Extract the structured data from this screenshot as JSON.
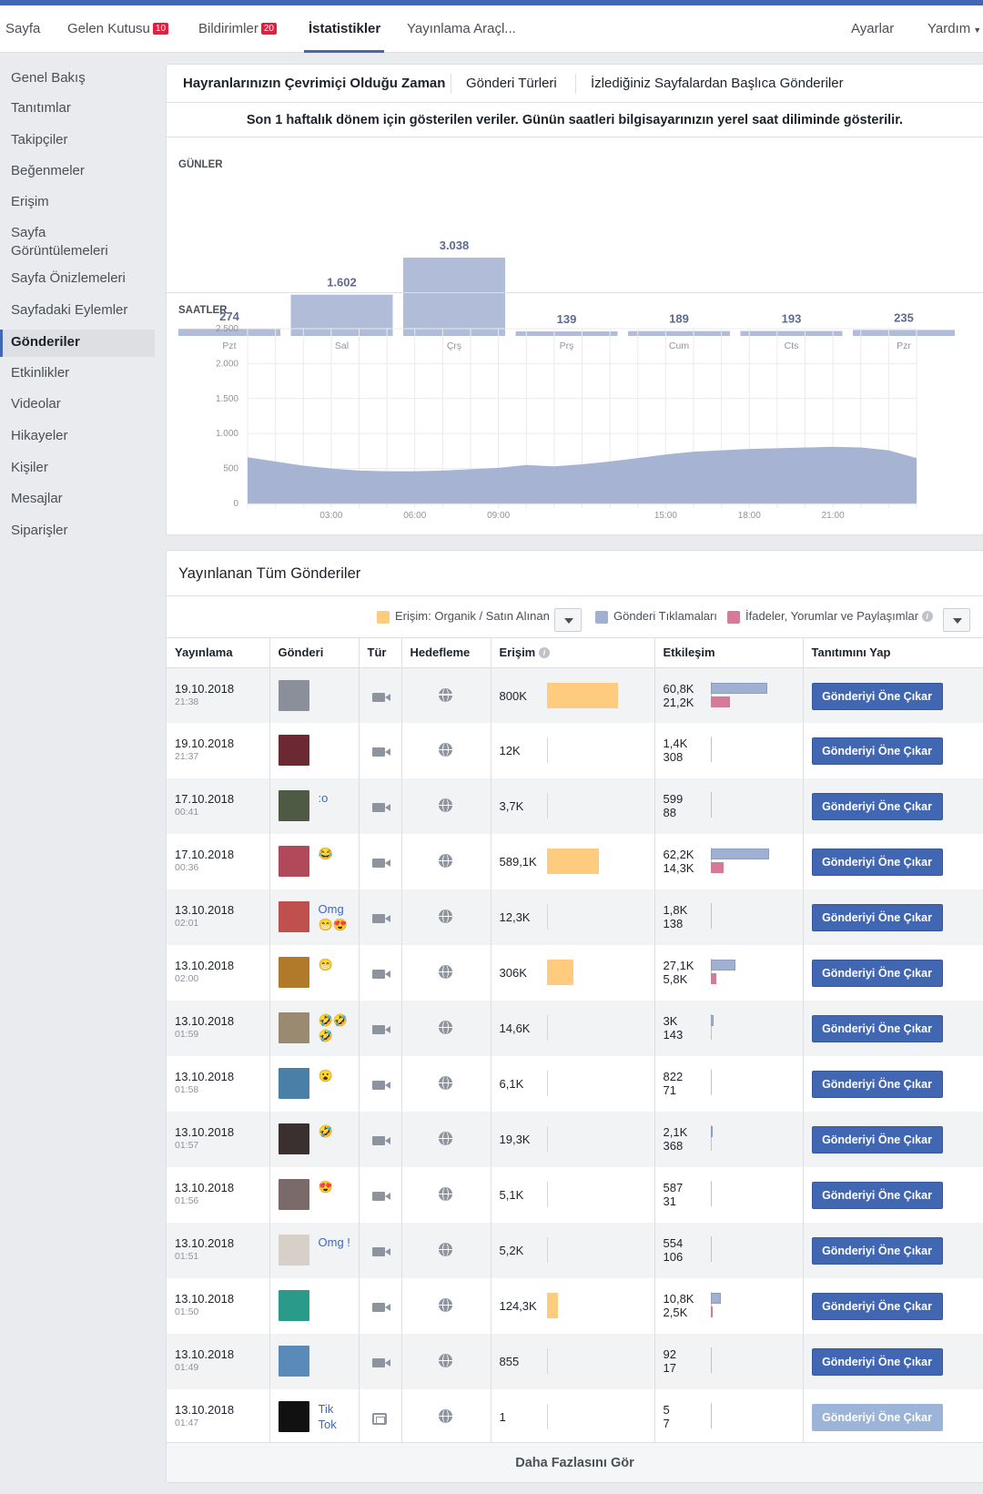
{
  "topnav": {
    "items": [
      {
        "label": "Sayfa"
      },
      {
        "label": "Gelen Kutusu",
        "badge": "10"
      },
      {
        "label": "Bildirimler",
        "badge": "20"
      },
      {
        "label": "İstatistikler"
      },
      {
        "label": "Yayınlama Araçl..."
      }
    ],
    "settings": "Ayarlar",
    "help": "Yardım"
  },
  "sidebar": {
    "items": [
      "Genel Bakış",
      "Tanıtımlar",
      "Takipçiler",
      "Beğenmeler",
      "Erişim",
      "Sayfa Görüntülemeleri",
      "Sayfa Önizlemeleri",
      "Sayfadaki Eylemler",
      "Gönderiler",
      "Etkinlikler",
      "Videolar",
      "Hikayeler",
      "Kişiler",
      "Mesajlar",
      "Siparişler"
    ],
    "active_index": 8
  },
  "insights": {
    "tabs": [
      "Hayranlarınızın Çevrimiçi Olduğu Zaman",
      "Gönderi Türleri",
      "İzlediğiniz Sayfalardan Başlıca Gönderiler"
    ],
    "notice": "Son 1 haftalık dönem için gösterilen veriler. Günün saatleri bilgisayarınızın yerel saat diliminde gösterilir.",
    "days_title": "GÜNLER",
    "hours_title": "SAATLER"
  },
  "chart_data": [
    {
      "type": "bar",
      "title": "GÜNLER",
      "categories": [
        "Pzt",
        "Sal",
        "Çrş",
        "Prş",
        "Cum",
        "Cts",
        "Pzr"
      ],
      "values": [
        274,
        1602,
        3038,
        139,
        189,
        193,
        235
      ],
      "value_labels": [
        "274",
        "1.602",
        "3.038",
        "139",
        "189",
        "193",
        "235"
      ],
      "color": "#b1bcd9"
    },
    {
      "type": "area",
      "title": "SAATLER",
      "x_ticks": [
        "03:00",
        "06:00",
        "09:00",
        "15:00",
        "18:00",
        "21:00"
      ],
      "y_ticks": [
        "0",
        "500",
        "1.000",
        "1.500",
        "2.000",
        "2.500"
      ],
      "ylim": [
        0,
        2500
      ],
      "x": [
        0,
        1,
        2,
        3,
        4,
        5,
        6,
        7,
        8,
        9,
        10,
        11,
        12,
        13,
        14,
        15,
        16,
        17,
        18,
        19,
        20,
        21,
        22,
        23,
        24
      ],
      "values": [
        660,
        600,
        540,
        500,
        470,
        460,
        460,
        470,
        490,
        510,
        550,
        530,
        560,
        600,
        650,
        700,
        740,
        760,
        780,
        790,
        800,
        810,
        800,
        760,
        650
      ],
      "color": "#a7b3d3",
      "grid": true
    }
  ],
  "posts": {
    "title": "Yayınlanan Tüm Gönderiler",
    "legend": {
      "reach": "Erişim: Organik / Satın Alınan",
      "clicks": "Gönderi Tıklamaları",
      "reactions": "İfadeler, Yorumlar ve Paylaşımlar",
      "reach_color": "#ffcc7f",
      "clicks_color": "#9fb0d3",
      "reactions_color": "#d77a98"
    },
    "columns": [
      "Yayınlama",
      "Gönderi",
      "Tür",
      "Hedefleme",
      "Erişim",
      "Etkileşim",
      "Tanıtımını Yap"
    ],
    "boost_label": "Gönderiyi Öne Çıkar",
    "more_label": "Daha Fazlasını Gör",
    "rows": [
      {
        "date": "19.10.2018",
        "time": "21:38",
        "text": "",
        "type": "video",
        "reach": "800K",
        "reach_value": 800000,
        "eng1": "60,8K",
        "eng1_value": 60800,
        "eng2": "21,2K",
        "eng2_value": 21200,
        "thumb_color": "#8a8f99",
        "boost_enabled": true
      },
      {
        "date": "19.10.2018",
        "time": "21:37",
        "text": "",
        "type": "video",
        "reach": "12K",
        "reach_value": 12000,
        "eng1": "1,4K",
        "eng1_value": 1400,
        "eng2": "308",
        "eng2_value": 308,
        "thumb_color": "#6b2a33",
        "boost_enabled": true
      },
      {
        "date": "17.10.2018",
        "time": "00:41",
        "text": ":o",
        "type": "video",
        "reach": "3,7K",
        "reach_value": 3700,
        "eng1": "599",
        "eng1_value": 599,
        "eng2": "88",
        "eng2_value": 88,
        "thumb_color": "#4f5a44",
        "boost_enabled": true
      },
      {
        "date": "17.10.2018",
        "time": "00:36",
        "text": "😂",
        "type": "video",
        "reach": "589,1K",
        "reach_value": 589100,
        "eng1": "62,2K",
        "eng1_value": 62200,
        "eng2": "14,3K",
        "eng2_value": 14300,
        "thumb_color": "#b04a5a",
        "boost_enabled": true
      },
      {
        "date": "13.10.2018",
        "time": "02:01",
        "text": "Omg 😁😍",
        "type": "video",
        "reach": "12,3K",
        "reach_value": 12300,
        "eng1": "1,8K",
        "eng1_value": 1800,
        "eng2": "138",
        "eng2_value": 138,
        "thumb_color": "#c0504d",
        "boost_enabled": true
      },
      {
        "date": "13.10.2018",
        "time": "02:00",
        "text": "😁",
        "type": "video",
        "reach": "306K",
        "reach_value": 306000,
        "eng1": "27,1K",
        "eng1_value": 27100,
        "eng2": "5,8K",
        "eng2_value": 5800,
        "thumb_color": "#b07a2a",
        "boost_enabled": true
      },
      {
        "date": "13.10.2018",
        "time": "01:59",
        "text": "🤣🤣🤣",
        "type": "video",
        "reach": "14,6K",
        "reach_value": 14600,
        "eng1": "3K",
        "eng1_value": 3000,
        "eng2": "143",
        "eng2_value": 143,
        "thumb_color": "#9a8a72",
        "boost_enabled": true
      },
      {
        "date": "13.10.2018",
        "time": "01:58",
        "text": "😮",
        "type": "video",
        "reach": "6,1K",
        "reach_value": 6100,
        "eng1": "822",
        "eng1_value": 822,
        "eng2": "71",
        "eng2_value": 71,
        "thumb_color": "#4a7fa8",
        "boost_enabled": true
      },
      {
        "date": "13.10.2018",
        "time": "01:57",
        "text": "🤣",
        "type": "video",
        "reach": "19,3K",
        "reach_value": 19300,
        "eng1": "2,1K",
        "eng1_value": 2100,
        "eng2": "368",
        "eng2_value": 368,
        "thumb_color": "#3a3030",
        "boost_enabled": true
      },
      {
        "date": "13.10.2018",
        "time": "01:56",
        "text": "😍",
        "type": "video",
        "reach": "5,1K",
        "reach_value": 5100,
        "eng1": "587",
        "eng1_value": 587,
        "eng2": "31",
        "eng2_value": 31,
        "thumb_color": "#7a6a6a",
        "boost_enabled": true
      },
      {
        "date": "13.10.2018",
        "time": "01:51",
        "text": "Omg !",
        "type": "video",
        "reach": "5,2K",
        "reach_value": 5200,
        "eng1": "554",
        "eng1_value": 554,
        "eng2": "106",
        "eng2_value": 106,
        "thumb_color": "#d6d0c8",
        "boost_enabled": true
      },
      {
        "date": "13.10.2018",
        "time": "01:50",
        "text": "",
        "type": "video",
        "reach": "124,3K",
        "reach_value": 124300,
        "eng1": "10,8K",
        "eng1_value": 10800,
        "eng2": "2,5K",
        "eng2_value": 2500,
        "thumb_color": "#2a9a8a",
        "boost_enabled": true
      },
      {
        "date": "13.10.2018",
        "time": "01:49",
        "text": "",
        "type": "video",
        "reach": "855",
        "reach_value": 855,
        "eng1": "92",
        "eng1_value": 92,
        "eng2": "17",
        "eng2_value": 17,
        "thumb_color": "#5a8ab8",
        "boost_enabled": true
      },
      {
        "date": "13.10.2018",
        "time": "01:47",
        "text": "Tik Tok",
        "type": "album",
        "reach": "1",
        "reach_value": 1,
        "eng1": "5",
        "eng1_value": 5,
        "eng2": "7",
        "eng2_value": 7,
        "thumb_color": "#111111",
        "boost_enabled": false
      }
    ]
  }
}
